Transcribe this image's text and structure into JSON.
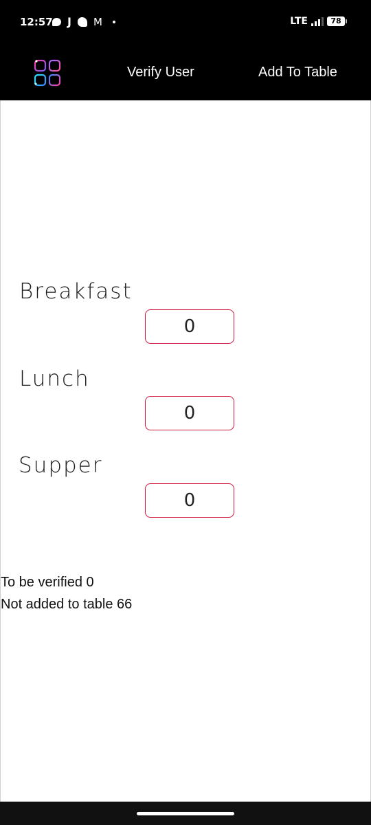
{
  "status_bar": {
    "time": "12:57",
    "notification_letter": "J",
    "gmail_glyph": "M",
    "network": "LTE",
    "battery": "78",
    "signal_level": 0.75
  },
  "app_bar": {
    "logo_icon": "app-grid-icon",
    "nav_verify": "Verify User",
    "nav_add": "Add To Table"
  },
  "meals": [
    {
      "label": "Breakfast",
      "value": "0"
    },
    {
      "label": "Lunch",
      "value": "0"
    },
    {
      "label": "Supper",
      "value": "0"
    }
  ],
  "summary": {
    "to_be_verified": "To be verified 0",
    "not_added": "Not added to table 66"
  },
  "colors": {
    "field_border": "#d0143c",
    "header_bg": "#000000",
    "content_bg": "#ffffff"
  }
}
